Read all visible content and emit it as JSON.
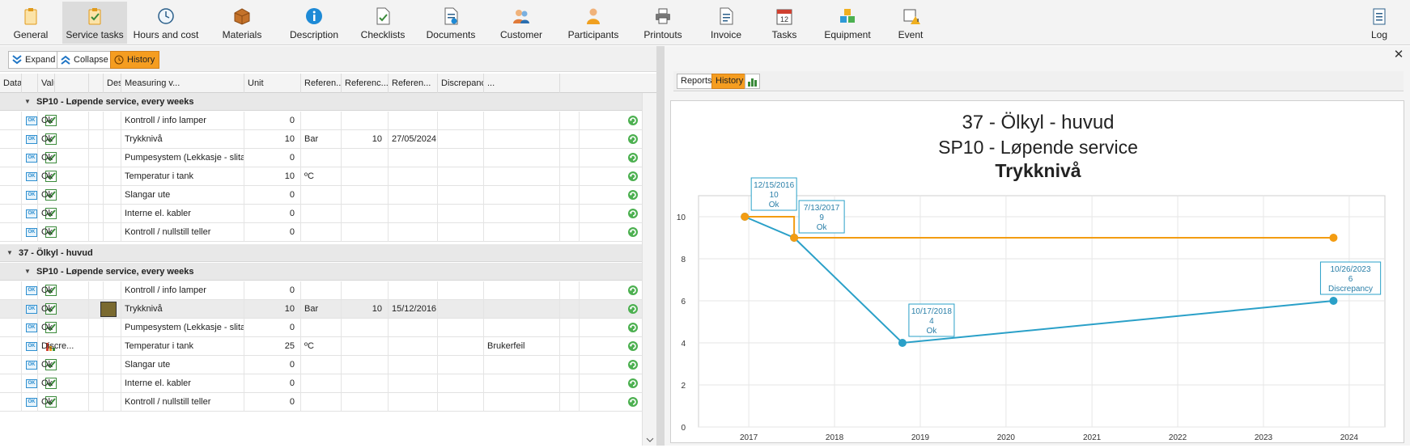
{
  "ribbon": {
    "items": [
      {
        "label": "General",
        "icon": "clipboard-icon"
      },
      {
        "label": "Service tasks",
        "icon": "clipboard-check-icon"
      },
      {
        "label": "Hours and cost",
        "icon": "clock-icon"
      },
      {
        "label": "Materials",
        "icon": "box-icon"
      },
      {
        "label": "Description",
        "icon": "info-icon"
      },
      {
        "label": "Checklists",
        "icon": "checklist-icon"
      },
      {
        "label": "Documents",
        "icon": "documents-icon"
      },
      {
        "label": "Customer",
        "icon": "customer-icon"
      },
      {
        "label": "Participants",
        "icon": "participant-icon"
      },
      {
        "label": "Printouts",
        "icon": "printer-icon"
      },
      {
        "label": "Invoice",
        "icon": "invoice-icon"
      },
      {
        "label": "Tasks",
        "icon": "calendar-icon"
      },
      {
        "label": "Equipment",
        "icon": "equipment-icon"
      },
      {
        "label": "Event",
        "icon": "event-icon"
      },
      {
        "label": "Log",
        "icon": "log-icon"
      }
    ],
    "active": "Service tasks"
  },
  "left_toolbar": {
    "expand": "Expand",
    "collapse": "Collapse",
    "history": "History"
  },
  "grid": {
    "headers": [
      "Data...",
      "",
      "Value",
      "",
      "",
      "Description",
      "Measuring v...",
      "Unit",
      "Referen...",
      "Referenc...",
      "Referen...",
      "Discrepancy",
      "..."
    ],
    "groups": [
      {
        "title": "SP10 - Løpende service, every  weeks",
        "level": 2,
        "rows": [
          {
            "status": "ok",
            "value": "Ok",
            "description": "Kontroll / info lamper",
            "measure": "0",
            "unit": "",
            "ref1": "",
            "ref2": "",
            "ref3": "",
            "discrepancy": ""
          },
          {
            "status": "ok",
            "value": "Ok",
            "description": "Trykknivå",
            "measure": "10",
            "unit": "Bar",
            "ref1": "10",
            "ref2": "27/05/2024",
            "ref3": "",
            "discrepancy": ""
          },
          {
            "status": "ok",
            "value": "Ok",
            "description": "Pumpesystem (Lekkasje - slita...",
            "measure": "0",
            "unit": "",
            "ref1": "",
            "ref2": "",
            "ref3": "",
            "discrepancy": ""
          },
          {
            "status": "ok",
            "value": "Ok",
            "description": "Temperatur i tank",
            "measure": "10",
            "unit": "ºC",
            "ref1": "",
            "ref2": "",
            "ref3": "",
            "discrepancy": ""
          },
          {
            "status": "ok",
            "value": "Ok",
            "description": "Slangar ute",
            "measure": "0",
            "unit": "",
            "ref1": "",
            "ref2": "",
            "ref3": "",
            "discrepancy": ""
          },
          {
            "status": "ok",
            "value": "Ok",
            "description": "Interne el. kabler",
            "measure": "0",
            "unit": "",
            "ref1": "",
            "ref2": "",
            "ref3": "",
            "discrepancy": ""
          },
          {
            "status": "ok",
            "value": "Ok",
            "description": "Kontroll / nullstill teller",
            "measure": "0",
            "unit": "",
            "ref1": "",
            "ref2": "",
            "ref3": "",
            "discrepancy": ""
          }
        ]
      },
      {
        "title": "37 - Ölkyl - huvud",
        "level": 1,
        "rows": []
      },
      {
        "title": "SP10 - Løpende service, every  weeks",
        "level": 2,
        "rows": [
          {
            "status": "ok",
            "value": "Ok",
            "description": "Kontroll / info lamper",
            "measure": "0",
            "unit": "",
            "ref1": "",
            "ref2": "",
            "ref3": "",
            "discrepancy": ""
          },
          {
            "status": "ok",
            "value": "Ok",
            "description": "Trykknivå",
            "measure": "10",
            "unit": "Bar",
            "ref1": "10",
            "ref2": "15/12/2016",
            "ref3": "",
            "discrepancy": "",
            "selected": true,
            "thumb": true
          },
          {
            "status": "ok",
            "value": "Ok",
            "description": "Pumpesystem (Lekkasje - slita...",
            "measure": "0",
            "unit": "",
            "ref1": "",
            "ref2": "",
            "ref3": "",
            "discrepancy": ""
          },
          {
            "status": "disc",
            "value": "Discre...",
            "description": "Temperatur i tank",
            "measure": "25",
            "unit": "ºC",
            "ref1": "",
            "ref2": "",
            "ref3": "",
            "discrepancy": "Brukerfeil"
          },
          {
            "status": "ok",
            "value": "Ok",
            "description": "Slangar ute",
            "measure": "0",
            "unit": "",
            "ref1": "",
            "ref2": "",
            "ref3": "",
            "discrepancy": ""
          },
          {
            "status": "ok",
            "value": "Ok",
            "description": "Interne el. kabler",
            "measure": "0",
            "unit": "",
            "ref1": "",
            "ref2": "",
            "ref3": "",
            "discrepancy": ""
          },
          {
            "status": "ok",
            "value": "Ok",
            "description": "Kontroll / nullstill teller",
            "measure": "0",
            "unit": "",
            "ref1": "",
            "ref2": "",
            "ref3": "",
            "discrepancy": ""
          }
        ]
      }
    ]
  },
  "right_tabs": {
    "reports": "Reports",
    "history": "History",
    "chart_icon": "bar-chart-icon"
  },
  "close_label": "✕",
  "colors": {
    "accent": "#f59d20",
    "series_orange": "#f39c12",
    "series_blue": "#2aa0c8",
    "ok_green": "#3a8a3a"
  },
  "chart_data": {
    "type": "line",
    "title": "37 - Ölkyl - huvud",
    "subtitle": "SP10 - Løpende service",
    "title3": "Trykknivå",
    "xlim": [
      "2016-06-01",
      "2024-06-01"
    ],
    "xticks": [
      "2017",
      "2018",
      "2019",
      "2020",
      "2021",
      "2022",
      "2023",
      "2024"
    ],
    "ylim": [
      0,
      11
    ],
    "yticks": [
      0,
      2,
      4,
      6,
      8,
      10
    ],
    "grid": true,
    "series": [
      {
        "color": "#f39c12",
        "step": true,
        "points": [
          {
            "x": "2016-12-15",
            "y": 10
          },
          {
            "x": "2017-07-13",
            "y": 9
          },
          {
            "x": "2023-10-26",
            "y": 9
          }
        ]
      },
      {
        "color": "#2aa0c8",
        "step": false,
        "points": [
          {
            "x": "2016-12-15",
            "y": 10
          },
          {
            "x": "2017-07-13",
            "y": 9
          },
          {
            "x": "2018-10-17",
            "y": 4
          },
          {
            "x": "2023-10-26",
            "y": 6
          }
        ]
      }
    ],
    "annotations": [
      {
        "x": "2016-12-15",
        "y": 10,
        "date": "12/15/2016",
        "value": "10",
        "status": "Ok"
      },
      {
        "x": "2017-07-13",
        "y": 9,
        "date": "7/13/2017",
        "value": "9",
        "status": "Ok"
      },
      {
        "x": "2018-10-17",
        "y": 4,
        "date": "10/17/2018",
        "value": "4",
        "status": "Ok"
      },
      {
        "x": "2023-10-26",
        "y": 6,
        "date": "10/26/2023",
        "value": "6",
        "status": "Discrepancy"
      }
    ]
  }
}
